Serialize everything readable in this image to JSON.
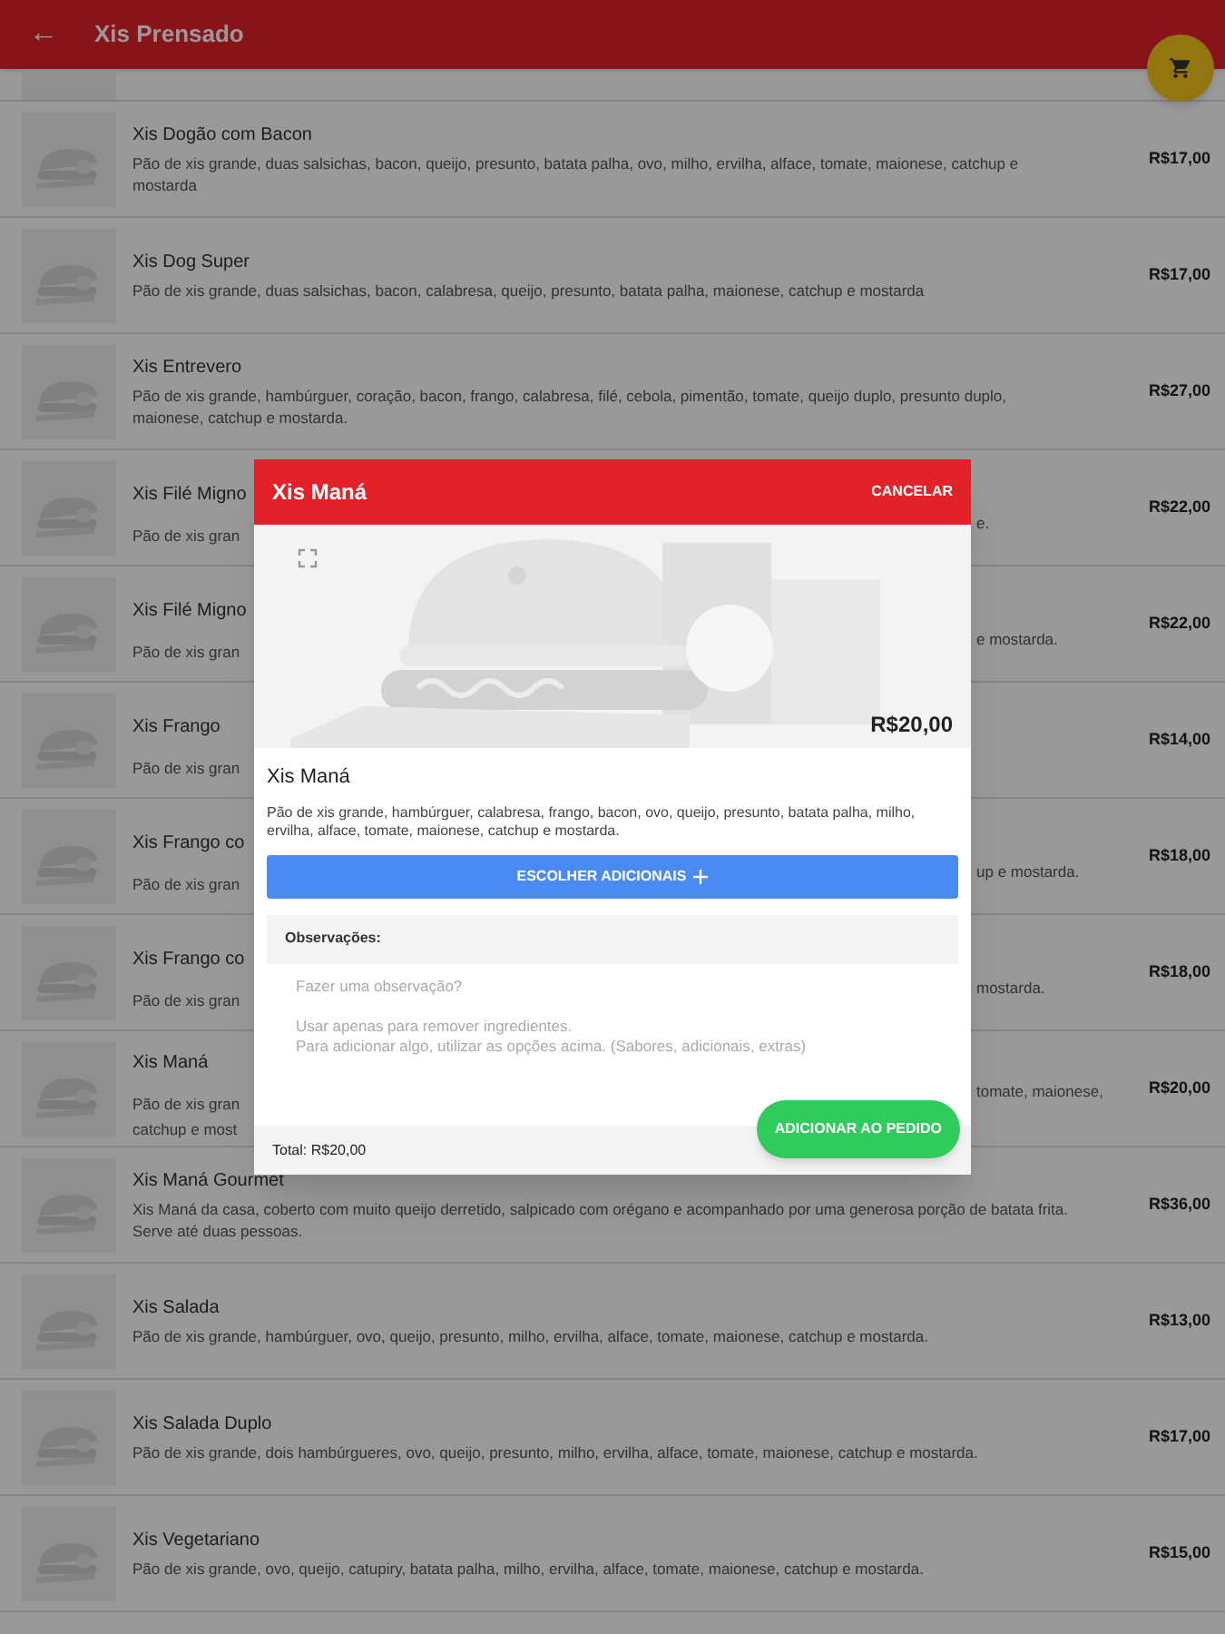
{
  "app_bar": {
    "back_icon": "←",
    "title": "Xis Prensado"
  },
  "products": [
    {
      "kind": "full",
      "name": "Xis Dogão com Bacon",
      "description": "Pão de xis grande, duas salsichas, bacon, queijo, presunto, batata palha, ovo, milho, ervilha, alface, tomate, maionese, catchup e mostarda",
      "price": "R$17,00"
    },
    {
      "kind": "full",
      "name": "Xis Dog Super",
      "description": "Pão de xis grande, duas salsichas, bacon, calabresa, queijo, presunto, batata palha, maionese, catchup e mostarda",
      "price": "R$17,00"
    },
    {
      "kind": "full",
      "name": "Xis Entrevero",
      "description": "Pão de xis grande, hambúrguer, coração, bacon, frango, calabresa, filé, cebola, pimentão, tomate, queijo duplo, presunto duplo, maionese, catchup e mostarda.",
      "price": "R$27,00"
    },
    {
      "kind": "covered",
      "name": "Xis Filé Migno",
      "lines": [
        {
          "left": "Pão de xis gran",
          "right": "e."
        }
      ],
      "price": "R$22,00"
    },
    {
      "kind": "covered",
      "name": "Xis Filé Migno",
      "lines": [
        {
          "left": "Pão de xis gran",
          "right": "e mostarda."
        }
      ],
      "price": "R$22,00"
    },
    {
      "kind": "covered",
      "name": "Xis Frango",
      "lines": [
        {
          "left": "Pão de xis gran"
        }
      ],
      "price": "R$14,00"
    },
    {
      "kind": "covered",
      "name": "Xis Frango co",
      "lines": [
        {
          "left": "Pão de xis gran",
          "right": "up e mostarda."
        }
      ],
      "price": "R$18,00"
    },
    {
      "kind": "covered",
      "name": "Xis Frango co",
      "lines": [
        {
          "left": "Pão de xis gran",
          "right": "mostarda."
        }
      ],
      "price": "R$18,00"
    },
    {
      "kind": "covered",
      "name": "Xis Maná",
      "lines": [
        {
          "left": "Pão de xis gran",
          "right": "tomate, maionese,"
        },
        {
          "left": "catchup e most"
        }
      ],
      "price": "R$20,00"
    },
    {
      "kind": "full",
      "name": "Xis Maná Gourmet",
      "description": "Xis Maná da casa, coberto com muito queijo derretido, salpicado com orégano e acompanhado por uma generosa porção de batata frita. Serve até duas pessoas.",
      "price": "R$36,00"
    },
    {
      "kind": "full",
      "name": "Xis Salada",
      "description": "Pão de xis grande, hambúrguer, ovo, queijo, presunto, milho, ervilha, alface, tomate, maionese, catchup e mostarda.",
      "price": "R$13,00"
    },
    {
      "kind": "full",
      "name": "Xis Salada Duplo",
      "description": "Pão de xis grande, dois hambúrgueres, ovo, queijo, presunto, milho, ervilha, alface, tomate, maionese, catchup e mostarda.",
      "price": "R$17,00"
    },
    {
      "kind": "full",
      "name": "Xis Vegetariano",
      "description": "Pão de xis grande, ovo, queijo, catupiry, batata palha, milho, ervilha, alface, tomate, maionese, catchup e mostarda.",
      "price": "R$15,00"
    }
  ],
  "dialog": {
    "title": "Xis Maná",
    "cancel": "CANCELAR",
    "price": "R$20,00",
    "name": "Xis Maná",
    "description": "Pão de xis grande, hambúrguer, calabresa, frango, bacon, ovo, queijo, presunto, batata palha, milho, ervilha, alface, tomate, maionese, catchup e mostarda.",
    "extras_button": "ESCOLHER ADICIONAIS",
    "notes_label": "Observações:",
    "notes_placeholder": "Fazer uma observação?\n\nUsar apenas para remover ingredientes.\nPara adicionar algo, utilizar as opções acima. (Sabores, adicionais, extras)",
    "total": "Total: R$20,00",
    "add_button": "ADICIONAR AO PEDIDO"
  }
}
